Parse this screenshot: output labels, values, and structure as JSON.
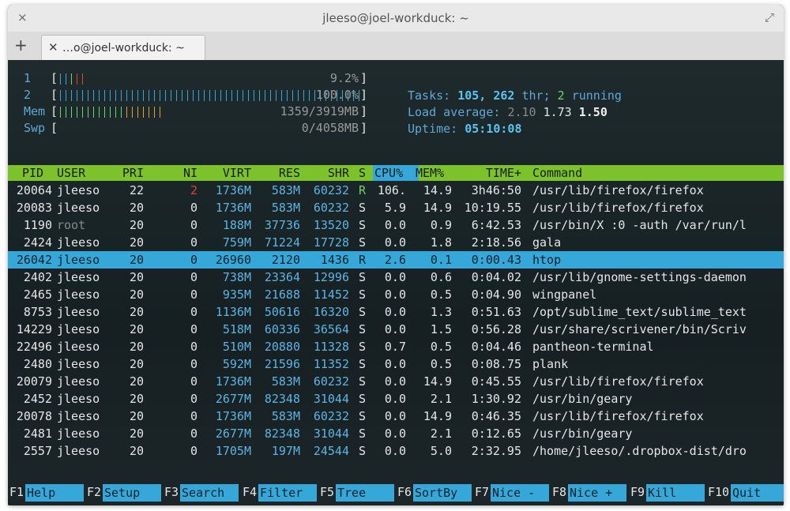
{
  "window": {
    "title": "jleeso@joel-workduck: ~"
  },
  "titlebar_icons": {
    "close": "×",
    "maximize": "⤢"
  },
  "tabs": {
    "new_tab": "+",
    "close": "✕",
    "label": "…o@joel-workduck: ~"
  },
  "meters": [
    {
      "label": "1",
      "value": "9.2%",
      "fill": 0.09
    },
    {
      "label": "2",
      "value": "100.0%",
      "fill": 1.0
    },
    {
      "label": "Mem",
      "value": "1359/3919MB",
      "fill": 0.35
    },
    {
      "label": "Swp",
      "value": "0/4058MB",
      "fill": 0.0
    }
  ],
  "stats": {
    "tasks_label": "Tasks:",
    "tasks_value": "105,",
    "threads": "262",
    "thr_label": "thr;",
    "running": "2",
    "running_label": "running",
    "load_label": "Load average:",
    "load1": "2.10",
    "load5": "1.73",
    "load15": "1.50",
    "uptime_label": "Uptime:",
    "uptime": "05:10:08"
  },
  "header": [
    "PID",
    "USER",
    "PRI",
    "NI",
    "VIRT",
    "RES",
    "SHR",
    "S",
    "CPU%",
    "MEM%",
    "TIME+",
    "Command"
  ],
  "rows": [
    {
      "pid": "20064",
      "user": "jleeso",
      "pri": "22",
      "ni": "2",
      "virt": "1736M",
      "res": "583M",
      "shr": "60232",
      "s": "R",
      "cpu": "106.",
      "mem": "14.9",
      "time": "3h46:50",
      "cmd": "/usr/lib/firefox/firefox"
    },
    {
      "pid": "20083",
      "user": "jleeso",
      "pri": "20",
      "ni": "0",
      "virt": "1736M",
      "res": "583M",
      "shr": "60232",
      "s": "S",
      "cpu": "5.9",
      "mem": "14.9",
      "time": "10:19.55",
      "cmd": "/usr/lib/firefox/firefox"
    },
    {
      "pid": "1190",
      "user": "root",
      "pri": "20",
      "ni": "0",
      "virt": "188M",
      "res": "37736",
      "shr": "13520",
      "s": "S",
      "cpu": "0.0",
      "mem": "0.9",
      "time": "6:42.53",
      "cmd": "/usr/bin/X :0 -auth /var/run/l"
    },
    {
      "pid": "2424",
      "user": "jleeso",
      "pri": "20",
      "ni": "0",
      "virt": "759M",
      "res": "71224",
      "shr": "17728",
      "s": "S",
      "cpu": "0.0",
      "mem": "1.8",
      "time": "2:18.56",
      "cmd": "gala"
    },
    {
      "pid": "26042",
      "user": "jleeso",
      "pri": "20",
      "ni": "0",
      "virt": "26960",
      "res": "2120",
      "shr": "1436",
      "s": "R",
      "cpu": "2.6",
      "mem": "0.1",
      "time": "0:00.43",
      "cmd": "htop"
    },
    {
      "pid": "2402",
      "user": "jleeso",
      "pri": "20",
      "ni": "0",
      "virt": "738M",
      "res": "23364",
      "shr": "12996",
      "s": "S",
      "cpu": "0.0",
      "mem": "0.6",
      "time": "0:04.02",
      "cmd": "/usr/lib/gnome-settings-daemon"
    },
    {
      "pid": "2465",
      "user": "jleeso",
      "pri": "20",
      "ni": "0",
      "virt": "935M",
      "res": "21688",
      "shr": "11452",
      "s": "S",
      "cpu": "0.0",
      "mem": "0.5",
      "time": "0:04.90",
      "cmd": "wingpanel"
    },
    {
      "pid": "8753",
      "user": "jleeso",
      "pri": "20",
      "ni": "0",
      "virt": "1136M",
      "res": "50616",
      "shr": "16320",
      "s": "S",
      "cpu": "0.0",
      "mem": "1.3",
      "time": "0:51.63",
      "cmd": "/opt/sublime_text/sublime_text"
    },
    {
      "pid": "14229",
      "user": "jleeso",
      "pri": "20",
      "ni": "0",
      "virt": "518M",
      "res": "60336",
      "shr": "36564",
      "s": "S",
      "cpu": "0.0",
      "mem": "1.5",
      "time": "0:56.28",
      "cmd": "/usr/share/scrivener/bin/Scriv"
    },
    {
      "pid": "22496",
      "user": "jleeso",
      "pri": "20",
      "ni": "0",
      "virt": "510M",
      "res": "20880",
      "shr": "11328",
      "s": "S",
      "cpu": "0.7",
      "mem": "0.5",
      "time": "0:04.46",
      "cmd": "pantheon-terminal"
    },
    {
      "pid": "2480",
      "user": "jleeso",
      "pri": "20",
      "ni": "0",
      "virt": "592M",
      "res": "21596",
      "shr": "11352",
      "s": "S",
      "cpu": "0.0",
      "mem": "0.5",
      "time": "0:08.75",
      "cmd": "plank"
    },
    {
      "pid": "20079",
      "user": "jleeso",
      "pri": "20",
      "ni": "0",
      "virt": "1736M",
      "res": "583M",
      "shr": "60232",
      "s": "S",
      "cpu": "0.0",
      "mem": "14.9",
      "time": "0:45.55",
      "cmd": "/usr/lib/firefox/firefox"
    },
    {
      "pid": "2452",
      "user": "jleeso",
      "pri": "20",
      "ni": "0",
      "virt": "2677M",
      "res": "82348",
      "shr": "31044",
      "s": "S",
      "cpu": "0.0",
      "mem": "2.1",
      "time": "1:30.92",
      "cmd": "/usr/bin/geary"
    },
    {
      "pid": "20078",
      "user": "jleeso",
      "pri": "20",
      "ni": "0",
      "virt": "1736M",
      "res": "583M",
      "shr": "60232",
      "s": "S",
      "cpu": "0.0",
      "mem": "14.9",
      "time": "0:46.35",
      "cmd": "/usr/lib/firefox/firefox"
    },
    {
      "pid": "2481",
      "user": "jleeso",
      "pri": "20",
      "ni": "0",
      "virt": "2677M",
      "res": "82348",
      "shr": "31044",
      "s": "S",
      "cpu": "0.0",
      "mem": "2.1",
      "time": "0:12.65",
      "cmd": "/usr/bin/geary"
    },
    {
      "pid": "2557",
      "user": "jleeso",
      "pri": "20",
      "ni": "0",
      "virt": "1705M",
      "res": "197M",
      "shr": "24544",
      "s": "S",
      "cpu": "0.0",
      "mem": "5.0",
      "time": "2:32.95",
      "cmd": "/home/jleeso/.dropbox-dist/dro"
    }
  ],
  "fkeys": [
    {
      "key": "F1",
      "label": "Help"
    },
    {
      "key": "F2",
      "label": "Setup"
    },
    {
      "key": "F3",
      "label": "Search"
    },
    {
      "key": "F4",
      "label": "Filter"
    },
    {
      "key": "F5",
      "label": "Tree"
    },
    {
      "key": "F6",
      "label": "SortBy"
    },
    {
      "key": "F7",
      "label": "Nice -"
    },
    {
      "key": "F8",
      "label": "Nice +"
    },
    {
      "key": "F9",
      "label": "Kill"
    },
    {
      "key": "F10",
      "label": "Quit"
    }
  ],
  "colors": {
    "header_bg": "#7cc22a",
    "selected_bg": "#35a7d9",
    "terminal_bg": "#1b2426"
  }
}
